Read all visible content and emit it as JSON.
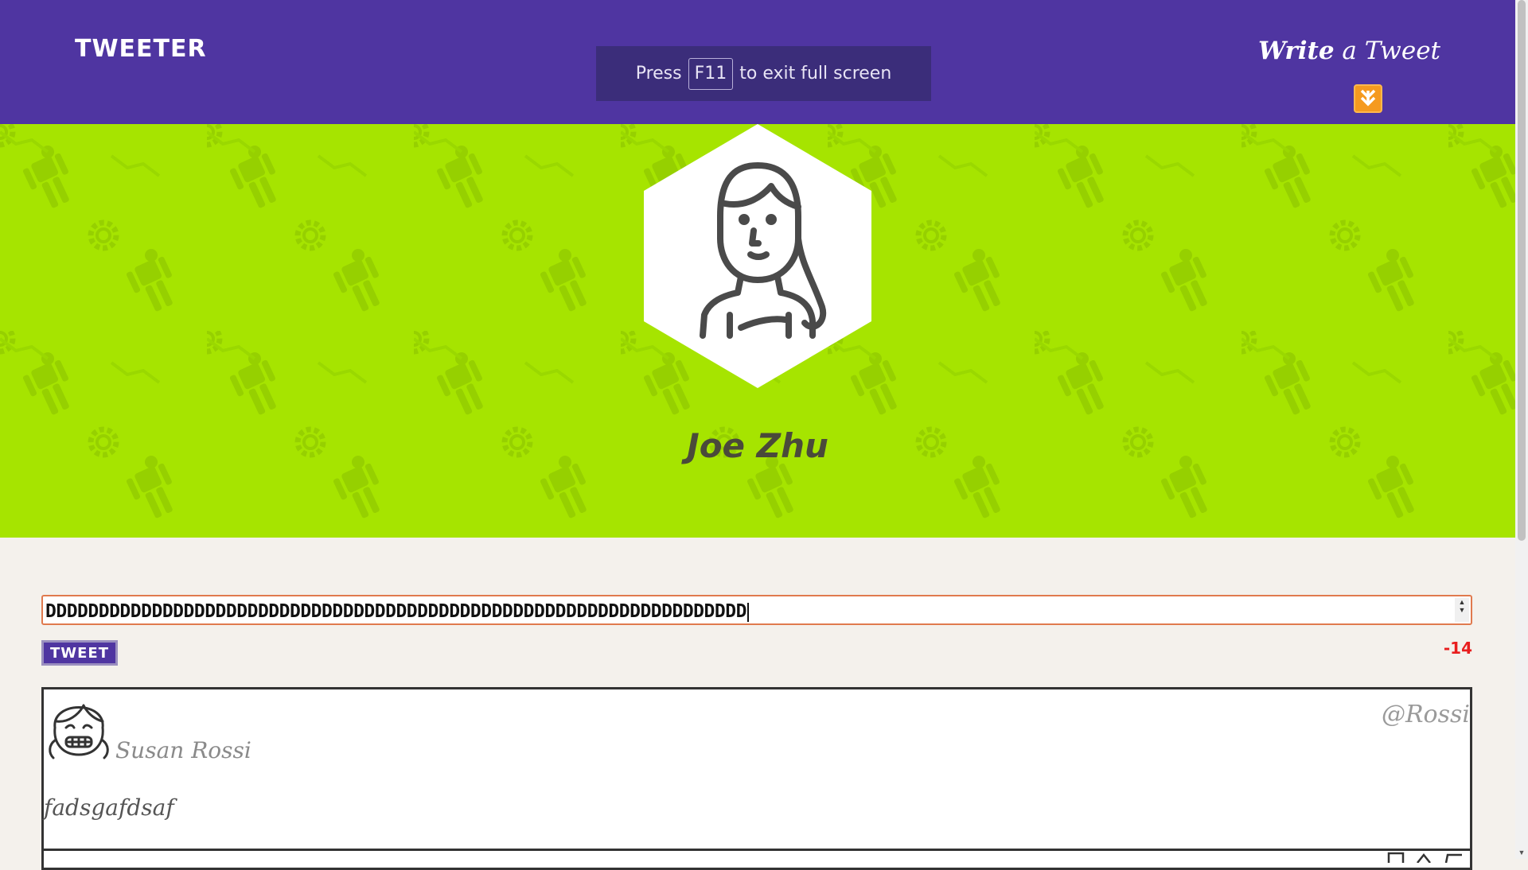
{
  "nav": {
    "brand": "TWEETER",
    "write_bold": "Write",
    "write_rest": " a Tweet",
    "arrow_icon": "double-chevron-down-icon"
  },
  "fullscreen_notice": {
    "press": "Press",
    "key": "F11",
    "rest": "to exit full screen"
  },
  "profile": {
    "name": "Joe Zhu",
    "avatar_icon": "woman-avatar-icon",
    "hero_color": "#a6e400"
  },
  "compose": {
    "value": "DDDDDDDDDDDDDDDDDDDDDDDDDDDDDDDDDDDDDDDDDDDDDDDDDDDDDDDDDDDDDDDDDD",
    "button_label": "TWEET",
    "counter": "-14"
  },
  "tweets": [
    {
      "name": "Susan Rossi",
      "handle": "@Rossi",
      "body": "fadsgafdsaf",
      "avatar_icon": "girl-avatar-icon"
    }
  ],
  "colors": {
    "nav": "#4f35a1",
    "accent": "#f59a1f",
    "counter": "#e81e1e"
  }
}
